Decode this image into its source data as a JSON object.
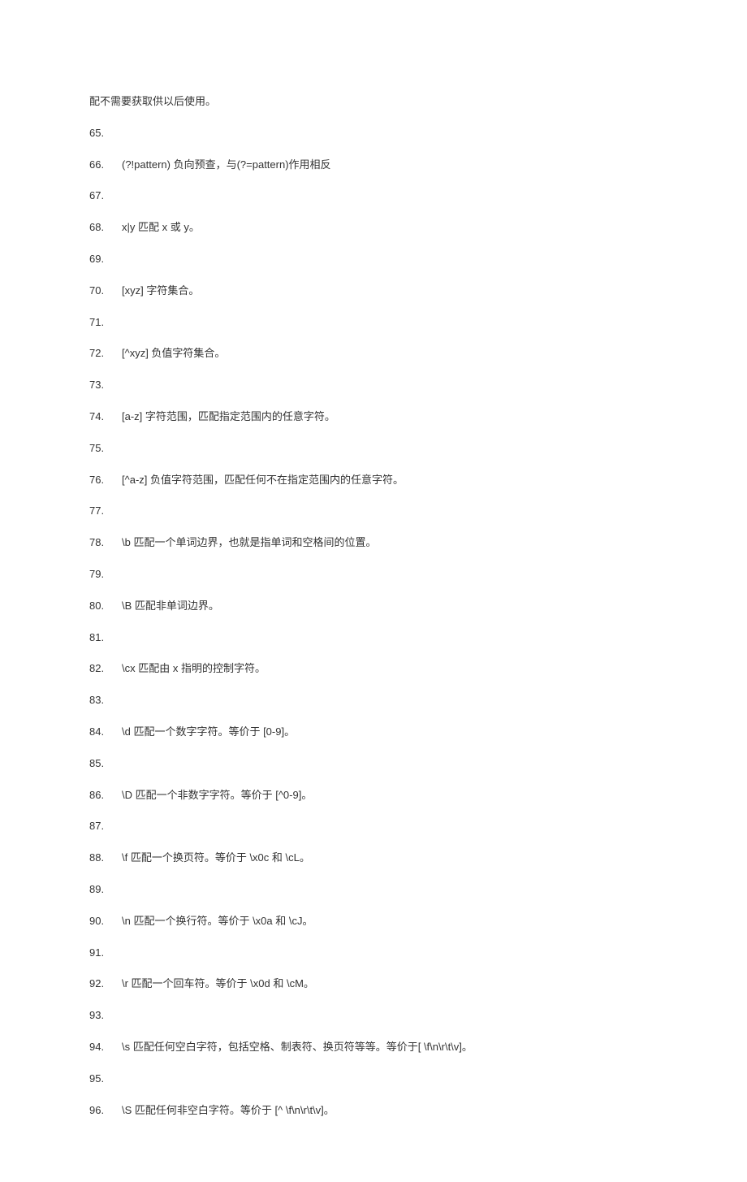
{
  "intro": "配不需要获取供以后使用。",
  "lines": [
    {
      "num": "65.",
      "text": ""
    },
    {
      "num": "66.",
      "text": "(?!pattern) 负向预查，与(?=pattern)作用相反"
    },
    {
      "num": "67.",
      "text": ""
    },
    {
      "num": "68.",
      "text": "x|y 匹配 x 或 y。"
    },
    {
      "num": "69.",
      "text": ""
    },
    {
      "num": "70.",
      "text": "[xyz] 字符集合。"
    },
    {
      "num": "71.",
      "text": ""
    },
    {
      "num": "72.",
      "text": "[^xyz] 负值字符集合。"
    },
    {
      "num": "73.",
      "text": ""
    },
    {
      "num": "74.",
      "text": "[a-z] 字符范围，匹配指定范围内的任意字符。"
    },
    {
      "num": "75.",
      "text": ""
    },
    {
      "num": "76.",
      "text": "[^a-z] 负值字符范围，匹配任何不在指定范围内的任意字符。"
    },
    {
      "num": "77.",
      "text": ""
    },
    {
      "num": "78.",
      "text": "\\b 匹配一个单词边界，也就是指单词和空格间的位置。"
    },
    {
      "num": "79.",
      "text": ""
    },
    {
      "num": "80.",
      "text": "\\B 匹配非单词边界。"
    },
    {
      "num": "81.",
      "text": ""
    },
    {
      "num": "82.",
      "text": "\\cx 匹配由 x 指明的控制字符。"
    },
    {
      "num": "83.",
      "text": ""
    },
    {
      "num": "84.",
      "text": "\\d 匹配一个数字字符。等价于 [0-9]。"
    },
    {
      "num": "85.",
      "text": ""
    },
    {
      "num": "86.",
      "text": "\\D 匹配一个非数字字符。等价于 [^0-9]。"
    },
    {
      "num": "87.",
      "text": ""
    },
    {
      "num": "88.",
      "text": "\\f 匹配一个换页符。等价于 \\x0c 和 \\cL。"
    },
    {
      "num": "89.",
      "text": ""
    },
    {
      "num": "90.",
      "text": "\\n 匹配一个换行符。等价于 \\x0a 和 \\cJ。"
    },
    {
      "num": "91.",
      "text": ""
    },
    {
      "num": "92.",
      "text": "\\r 匹配一个回车符。等价于 \\x0d 和 \\cM。"
    },
    {
      "num": "93.",
      "text": ""
    },
    {
      "num": "94.",
      "text": "\\s 匹配任何空白字符，包括空格、制表符、换页符等等。等价于[ \\f\\n\\r\\t\\v]。"
    },
    {
      "num": "95.",
      "text": ""
    },
    {
      "num": "96.",
      "text": "\\S 匹配任何非空白字符。等价于 [^ \\f\\n\\r\\t\\v]。"
    }
  ]
}
